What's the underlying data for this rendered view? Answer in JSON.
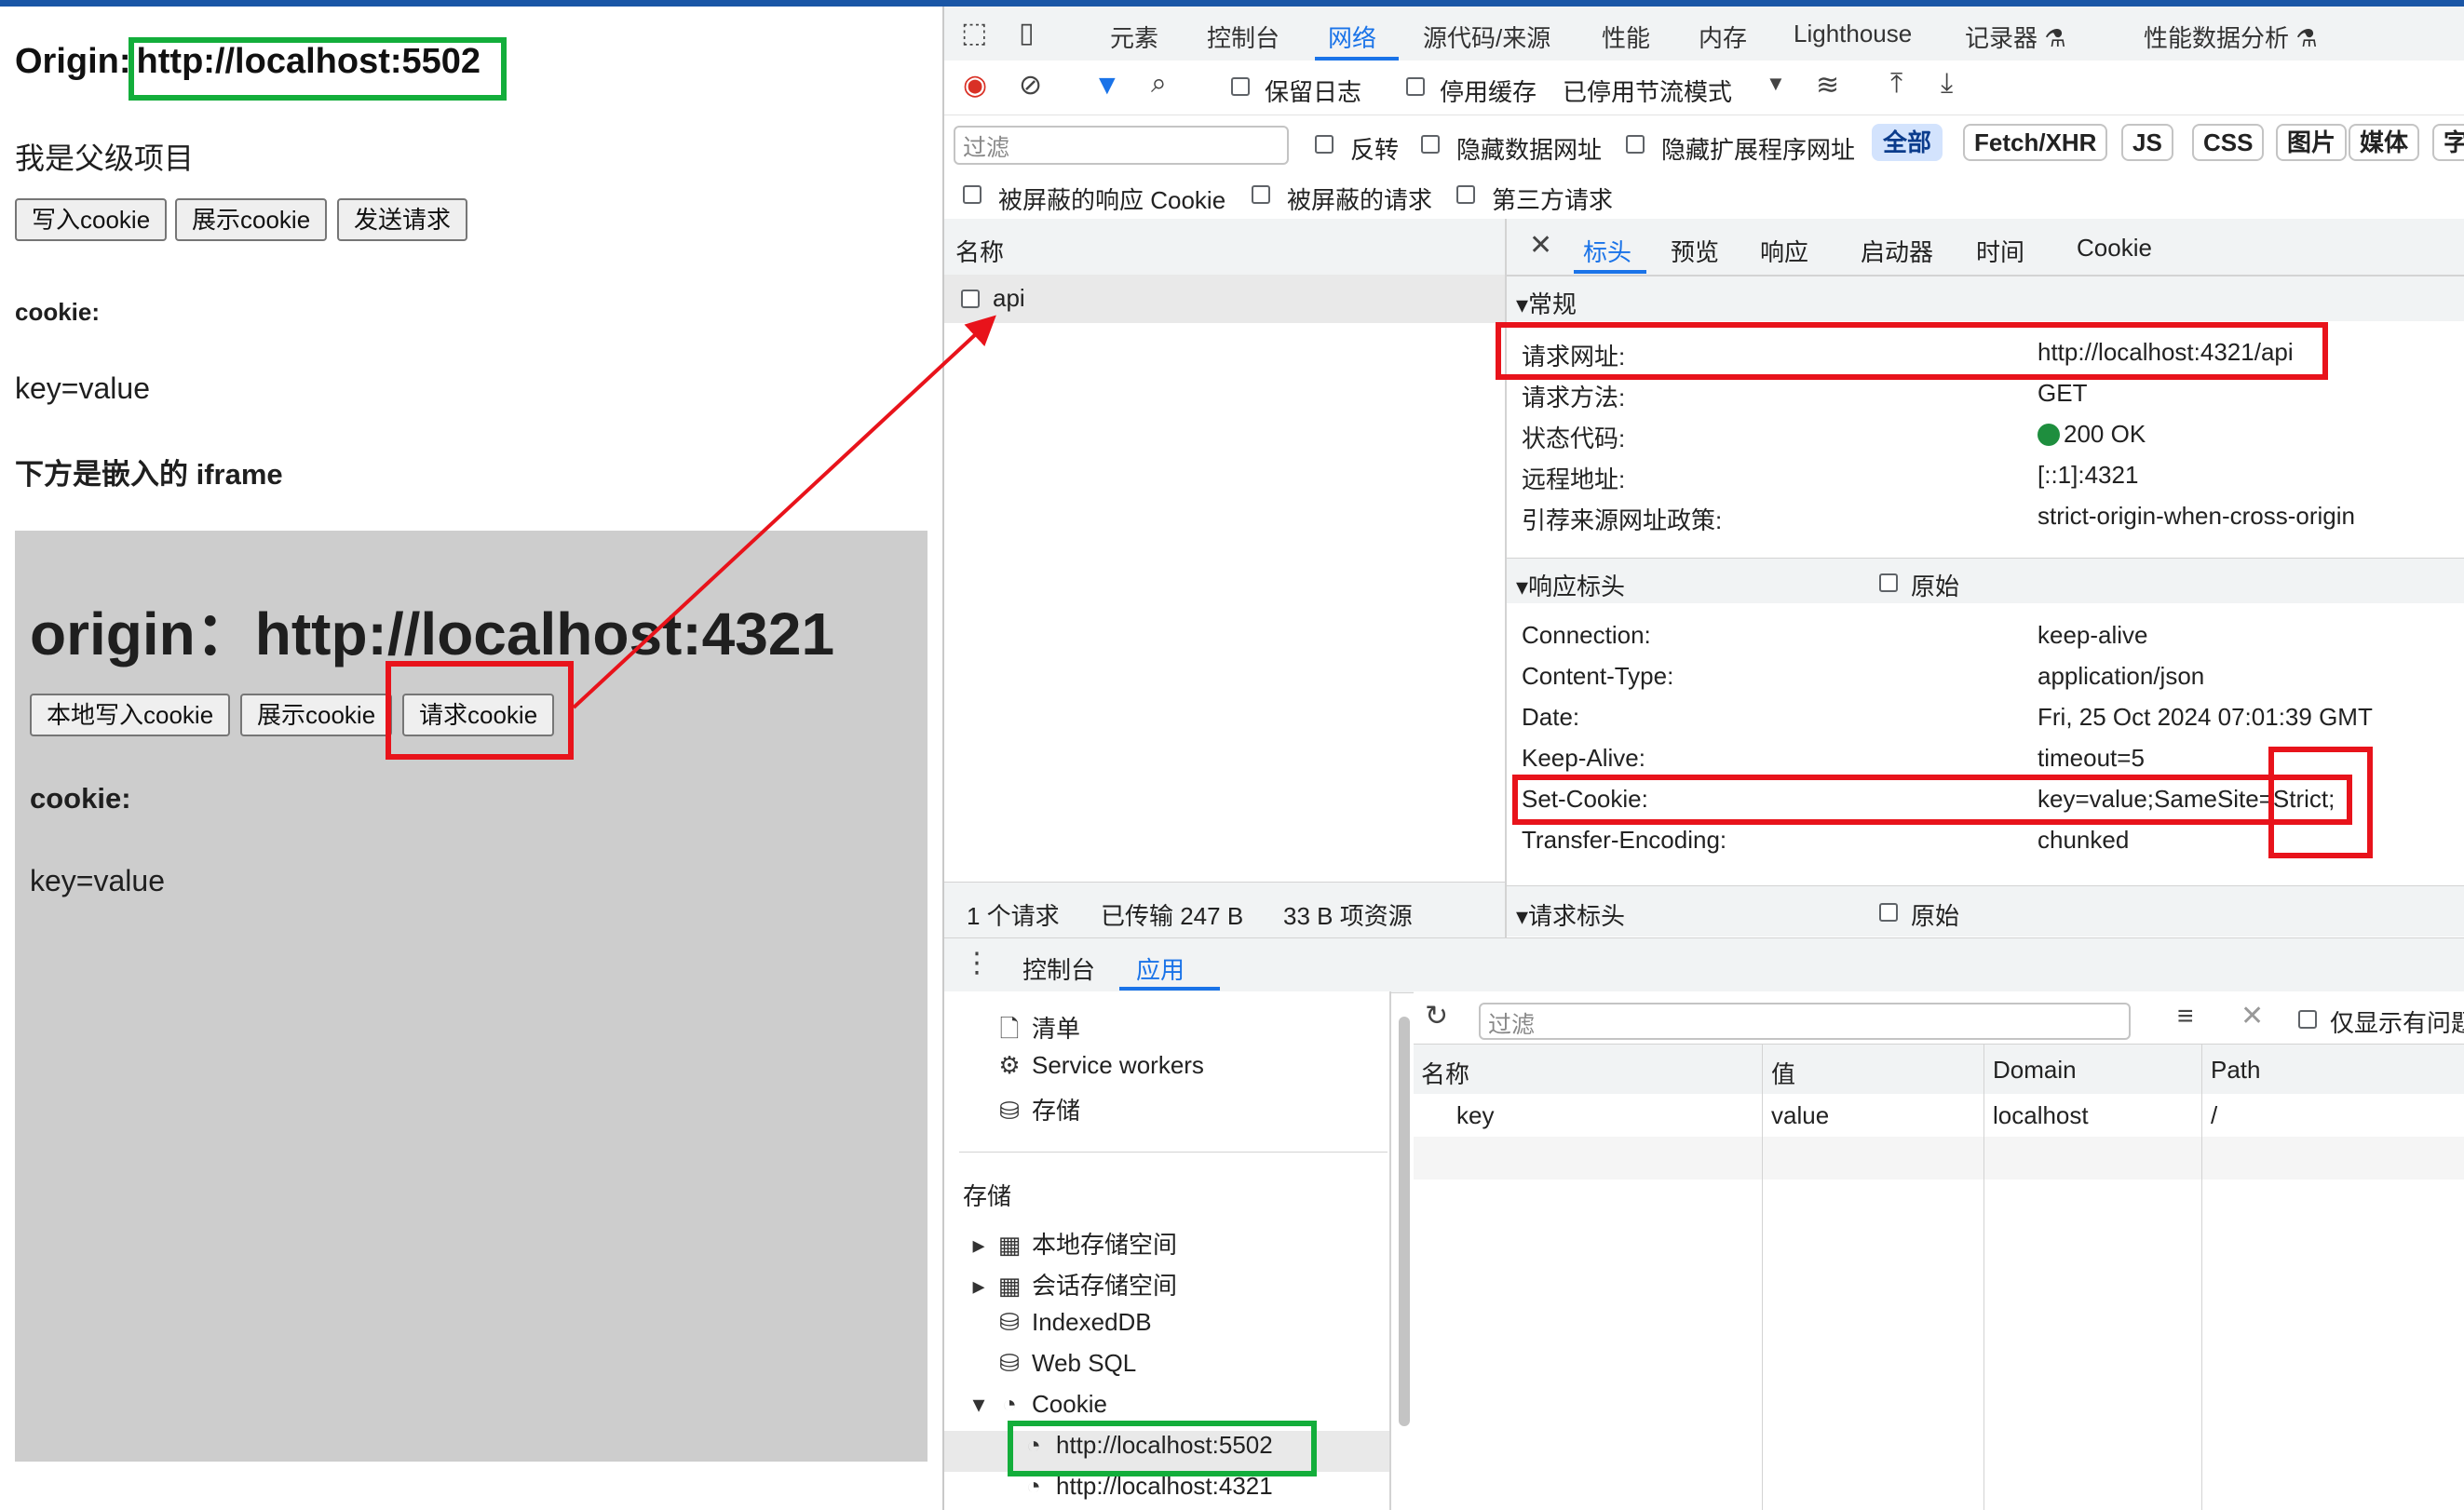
{
  "left_page": {
    "origin_label": "Origin:",
    "origin_url": "http://localhost:5502",
    "parent_title": "我是父级项目",
    "buttons": [
      "写入cookie",
      "展示cookie",
      "发送请求"
    ],
    "cookie_label": "cookie:",
    "cookie_value": "key=value",
    "iframe_label": "下方是嵌入的 iframe",
    "iframe": {
      "origin_title": "origin：http://localhost:4321",
      "buttons": [
        "本地写入cookie",
        "展示cookie",
        "请求cookie"
      ],
      "cookie_label": "cookie:",
      "cookie_value": "key=value"
    }
  },
  "devtools": {
    "main_tabs": [
      "元素",
      "控制台",
      "网络",
      "源代码/来源",
      "性能",
      "内存",
      "Lighthouse",
      "记录器 ⚗",
      "性能数据分析 ⚗"
    ],
    "active_tab": "网络",
    "toolbar": {
      "preserve_log": "保留日志",
      "disable_cache": "停用缓存",
      "throttle": "已停用节流模式"
    },
    "filter": {
      "placeholder": "过滤",
      "invert": "反转",
      "hide_data_urls": "隐藏数据网址",
      "hide_ext_urls": "隐藏扩展程序网址",
      "types": [
        "全部",
        "Fetch/XHR",
        "JS",
        "CSS",
        "图片",
        "媒体",
        "字"
      ],
      "blocked_cookies": "被屏蔽的响应 Cookie",
      "blocked_requests": "被屏蔽的请求",
      "third_party": "第三方请求"
    },
    "request_list": {
      "header": "名称",
      "rows": [
        "api"
      ],
      "footer": [
        "1 个请求",
        "已传输 247 B",
        "33 B 项资源"
      ]
    },
    "detail_tabs": [
      "标头",
      "预览",
      "响应",
      "启动器",
      "时间",
      "Cookie"
    ],
    "general": {
      "title": "▾常规",
      "rows": [
        {
          "k": "请求网址:",
          "v": "http://localhost:4321/api"
        },
        {
          "k": "请求方法:",
          "v": "GET"
        },
        {
          "k": "状态代码:",
          "v": "200 OK"
        },
        {
          "k": "远程地址:",
          "v": "[::1]:4321"
        },
        {
          "k": "引荐来源网址政策:",
          "v": "strict-origin-when-cross-origin"
        }
      ]
    },
    "response_headers": {
      "title": "▾响应标头",
      "raw": "原始",
      "rows": [
        {
          "k": "Connection:",
          "v": "keep-alive"
        },
        {
          "k": "Content-Type:",
          "v": "application/json"
        },
        {
          "k": "Date:",
          "v": "Fri, 25 Oct 2024 07:01:39 GMT"
        },
        {
          "k": "Keep-Alive:",
          "v": "timeout=5"
        },
        {
          "k": "Set-Cookie:",
          "v": "key=value;SameSite=Strict;"
        },
        {
          "k": "Transfer-Encoding:",
          "v": "chunked"
        }
      ]
    },
    "request_headers": {
      "title": "▾请求标头",
      "raw": "原始"
    },
    "drawer_tabs": [
      "控制台",
      "应用"
    ],
    "app_sidebar": {
      "items_top": [
        "清单",
        "Service workers",
        "存储"
      ],
      "storage_header": "存储",
      "storage_items": [
        "本地存储空间",
        "会话存储空间",
        "IndexedDB",
        "Web SQL",
        "Cookie"
      ],
      "cookie_children": [
        "http://localhost:5502",
        "http://localhost:4321"
      ]
    },
    "cookie_table": {
      "filter_placeholder": "过滤",
      "only_issues": "仅显示有问题",
      "columns": [
        "名称",
        "值",
        "Domain",
        "Path"
      ],
      "rows": [
        [
          "key",
          "value",
          "localhost",
          "/"
        ]
      ]
    }
  },
  "colors": {
    "highlight_red": "#e8131b",
    "highlight_green": "#13ae3b",
    "accent": "#1a73e8"
  }
}
